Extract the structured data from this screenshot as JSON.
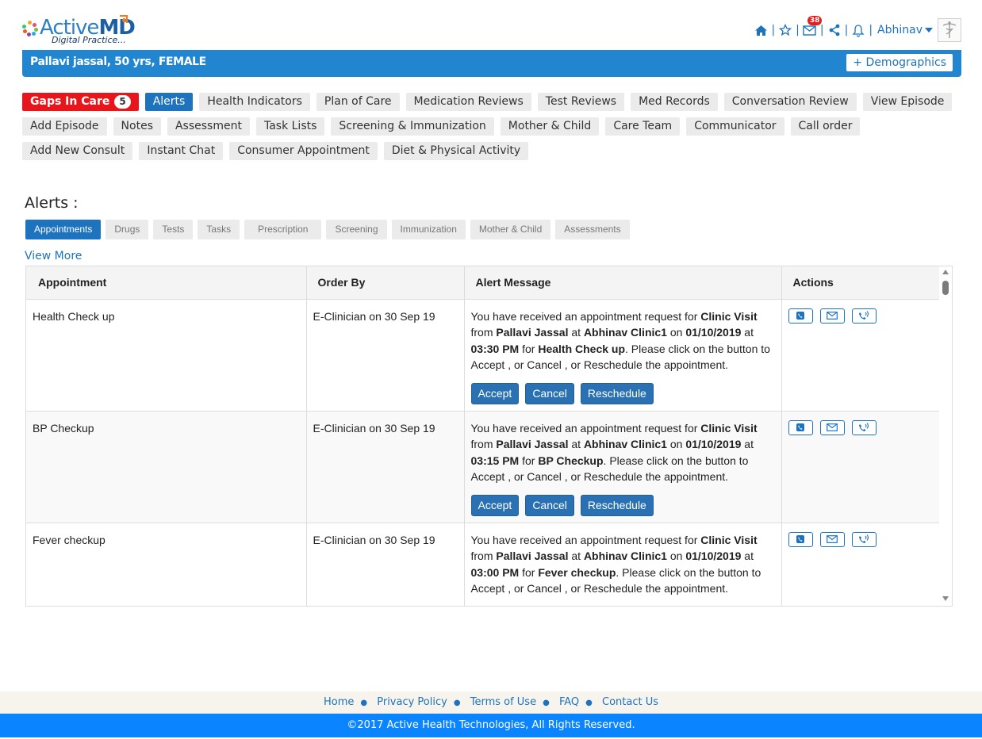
{
  "header": {
    "brand_main": "Active",
    "brand_bold": "MD",
    "brand_tagline": "Digital Practice...",
    "mail_count": "38",
    "user_name": "Abhinav"
  },
  "patient": {
    "summary": "Pallavi jassal, 50 yrs, FEMALE",
    "demographics_label": "+ Demographics"
  },
  "nav": {
    "gaps_label": "Gaps In Care",
    "gaps_count": "5",
    "row1": [
      "Alerts",
      "Health Indicators",
      "Plan of Care",
      "Medication Reviews",
      "Test Reviews",
      "Med Records",
      "Conversation Review",
      "View Episode"
    ],
    "row2": [
      "Add Episode",
      "Notes",
      "Assessment",
      "Task Lists",
      "Screening & Immunization",
      "Mother & Child",
      "Care Team",
      "Communicator",
      "Call order"
    ],
    "row3": [
      "Add New Consult",
      "Instant Chat",
      "Consumer Appointment",
      "Diet & Physical Activity"
    ]
  },
  "alerts": {
    "title": "Alerts :",
    "subtabs": [
      "Appointments",
      "Drugs",
      "Tests",
      "Tasks",
      "Prescription",
      "Screening",
      "Immunization",
      "Mother & Child",
      "Assessments"
    ],
    "view_more": "View More",
    "columns": [
      "Appointment",
      "Order By",
      "Alert Message",
      "Actions"
    ],
    "buttons": {
      "accept": "Accept",
      "cancel": "Cancel",
      "reschedule": "Reschedule"
    },
    "rows": [
      {
        "appointment": "Health Check up",
        "order_by": "E-Clinician on 30 Sep 19",
        "msg_pre": "You have received an appointment request for ",
        "visit_type": "Clinic Visit",
        "msg_from": " from ",
        "patient": "Pallavi Jassal",
        "msg_at": " at ",
        "clinic": "Abhinav Clinic1",
        "msg_on": " on ",
        "date": "01/10/2019",
        "msg_at2": " at ",
        "time": "03:30 PM",
        "msg_for": " for ",
        "reason": "Health Check up",
        "msg_post": ". Please click on the button to Accept , or Cancel , or Reschedule the appointment."
      },
      {
        "appointment": "BP Checkup",
        "order_by": "E-Clinician on 30 Sep 19",
        "msg_pre": "You have received an appointment request for ",
        "visit_type": "Clinic Visit",
        "msg_from": " from ",
        "patient": "Pallavi Jassal",
        "msg_at": " at ",
        "clinic": "Abhinav Clinic1",
        "msg_on": " on ",
        "date": "01/10/2019",
        "msg_at2": " at ",
        "time": "03:15 PM",
        "msg_for": " for ",
        "reason": "BP Checkup",
        "msg_post": ". Please click on the button to Accept , or Cancel , or Reschedule the appointment."
      },
      {
        "appointment": "Fever checkup",
        "order_by": "E-Clinician on 30 Sep 19",
        "msg_pre": "You have received an appointment request for ",
        "visit_type": "Clinic Visit",
        "msg_from": " from ",
        "patient": "Pallavi Jassal",
        "msg_at": " at ",
        "clinic": "Abhinav Clinic1",
        "msg_on": " on ",
        "date": "01/10/2019",
        "msg_at2": " at ",
        "time": "03:00 PM",
        "msg_for": " for ",
        "reason": "Fever checkup",
        "msg_post": ". Please click on the button to Accept , or Cancel , or Reschedule the appointment."
      }
    ]
  },
  "footer": {
    "links": [
      "Home",
      "Privacy Policy",
      "Terms of Use",
      "FAQ",
      "Contact Us"
    ],
    "copyright": "©2017 Active Health Technologies, All Rights Reserved."
  },
  "colors": {
    "primary": "#1e73be",
    "patient_bar": "#2185d0",
    "gaps_red": "#e8161b",
    "footer_blue": "#0a84ff"
  }
}
